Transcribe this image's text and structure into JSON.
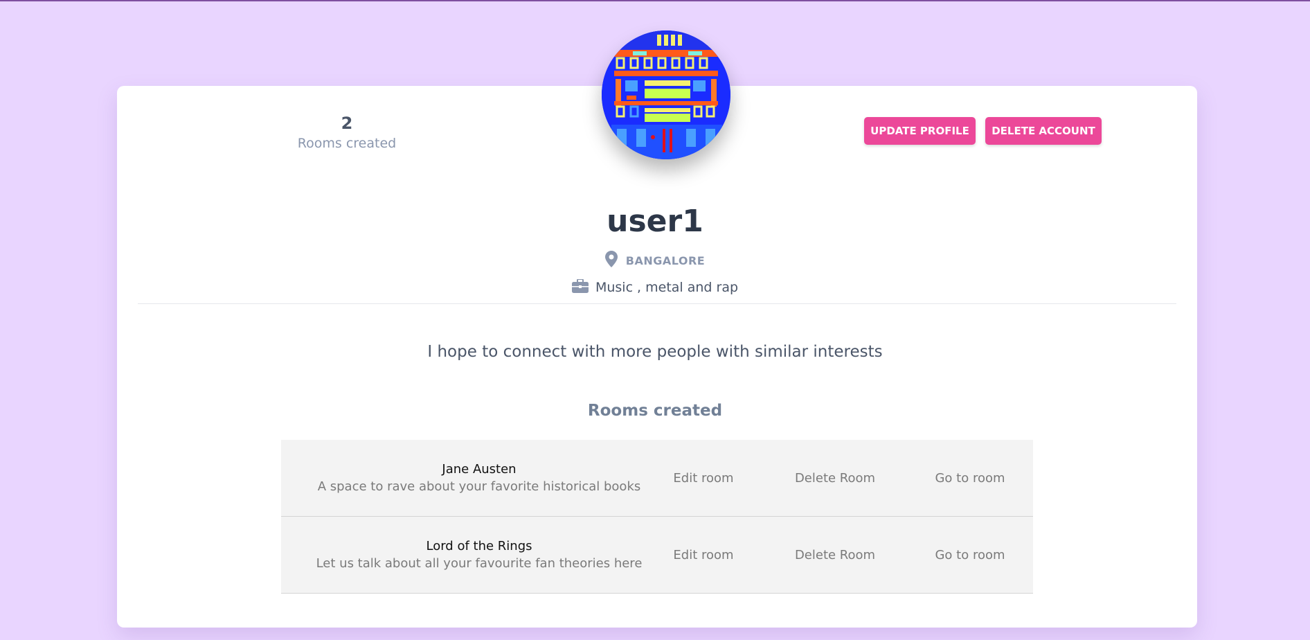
{
  "profile": {
    "username": "user1",
    "location": "BANGALORE",
    "interests": "Music , metal and rap",
    "bio": "I hope to connect with more people with similar interests"
  },
  "stats": {
    "rooms_count": "2",
    "rooms_label": "Rooms created"
  },
  "actions": {
    "update_label": "UPDATE PROFILE",
    "delete_label": "DELETE ACCOUNT"
  },
  "rooms": {
    "heading": "Rooms created",
    "items": [
      {
        "name": "Jane Austen",
        "description": "A space to rave about your favorite historical books",
        "edit": "Edit room",
        "delete": "Delete Room",
        "go": "Go to room"
      },
      {
        "name": "Lord of the Rings",
        "description": "Let us talk about all your favourite fan theories here",
        "edit": "Edit room",
        "delete": "Delete Room",
        "go": "Go to room"
      }
    ]
  },
  "colors": {
    "page_background": "#e9d5ff",
    "accent": "#ec4899",
    "card": "#ffffff",
    "heading_text": "#2d3748",
    "muted_text": "#8a96ad"
  },
  "icons": {
    "location": "map-pin-icon",
    "interests": "briefcase-icon"
  }
}
